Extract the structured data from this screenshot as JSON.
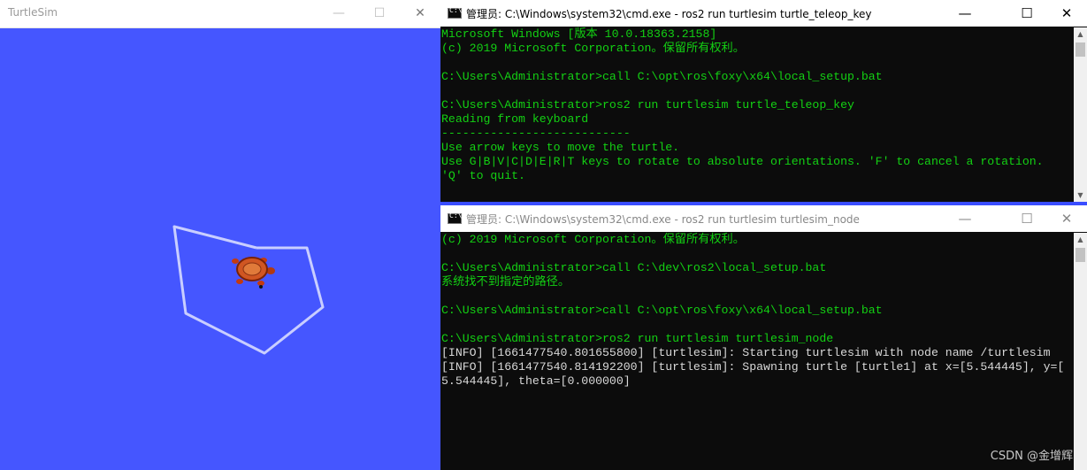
{
  "turtlesim": {
    "title": "TurtleSim",
    "bg_color": "#4556ff",
    "controls": {
      "minimize": "—",
      "maximize": "☐",
      "close": "✕"
    }
  },
  "cmd_teleop": {
    "title": "管理员: C:\\Windows\\system32\\cmd.exe - ros2  run turtlesim turtle_teleop_key",
    "lines": [
      "Microsoft Windows [版本 10.0.18363.2158]",
      "(c) 2019 Microsoft Corporation。保留所有权利。",
      "",
      "C:\\Users\\Administrator>call C:\\opt\\ros\\foxy\\x64\\local_setup.bat",
      "",
      "C:\\Users\\Administrator>ros2 run turtlesim turtle_teleop_key",
      "Reading from keyboard",
      "---------------------------",
      "Use arrow keys to move the turtle.",
      "Use G|B|V|C|D|E|R|T keys to rotate to absolute orientations. 'F' to cancel a rotation.",
      "'Q' to quit."
    ]
  },
  "cmd_node": {
    "title": "管理员: C:\\Windows\\system32\\cmd.exe - ros2  run turtlesim turtlesim_node",
    "lines": [
      "(c) 2019 Microsoft Corporation。保留所有权利。",
      "",
      "C:\\Users\\Administrator>call C:\\dev\\ros2\\local_setup.bat",
      "系统找不到指定的路径。",
      "",
      "C:\\Users\\Administrator>call C:\\opt\\ros\\foxy\\x64\\local_setup.bat",
      "",
      "C:\\Users\\Administrator>ros2 run turtlesim turtlesim_node",
      "[INFO] [1661477540.801655800] [turtlesim]: Starting turtlesim with node name /turtlesim",
      "[INFO] [1661477540.814192200] [turtlesim]: Spawning turtle [turtle1] at x=[5.544445], y=[",
      "5.544445], theta=[0.000000]"
    ]
  },
  "watermark": "CSDN @金增辉"
}
